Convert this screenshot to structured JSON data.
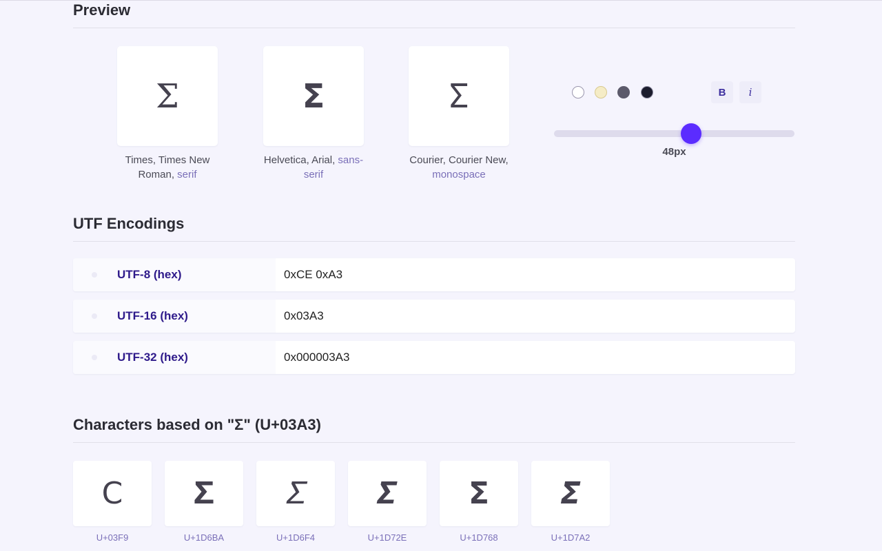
{
  "preview": {
    "title": "Preview",
    "glyph": "Σ",
    "fonts": [
      {
        "prefix": "Times, Times New Roman, ",
        "family": "serif"
      },
      {
        "prefix": "Helvetica, Arial, ",
        "family": "sans-serif"
      },
      {
        "prefix": "Courier, Courier New, ",
        "family": "monospace"
      }
    ],
    "colors": [
      "#ffffff",
      "#f5ecc6",
      "#5c5a6b",
      "#1c1d2e"
    ],
    "bold_label": "B",
    "italic_label": "i",
    "size_label": "48px",
    "size_fraction": 0.57
  },
  "utf": {
    "title": "UTF Encodings",
    "rows": [
      {
        "label": "UTF-8 (hex)",
        "value": "0xCE 0xA3"
      },
      {
        "label": "UTF-16 (hex)",
        "value": "0x03A3"
      },
      {
        "label": "UTF-32 (hex)",
        "value": "0x000003A3"
      }
    ]
  },
  "related": {
    "title": "Characters based on \"Σ\" (U+03A3)",
    "items": [
      {
        "glyph": "Ϲ",
        "code": "U+03F9"
      },
      {
        "glyph": "𝚺",
        "code": "U+1D6BA"
      },
      {
        "glyph": "𝛴",
        "code": "U+1D6F4"
      },
      {
        "glyph": "𝜮",
        "code": "U+1D72E"
      },
      {
        "glyph": "𝝨",
        "code": "U+1D768"
      },
      {
        "glyph": "𝞢",
        "code": "U+1D7A2"
      }
    ]
  }
}
